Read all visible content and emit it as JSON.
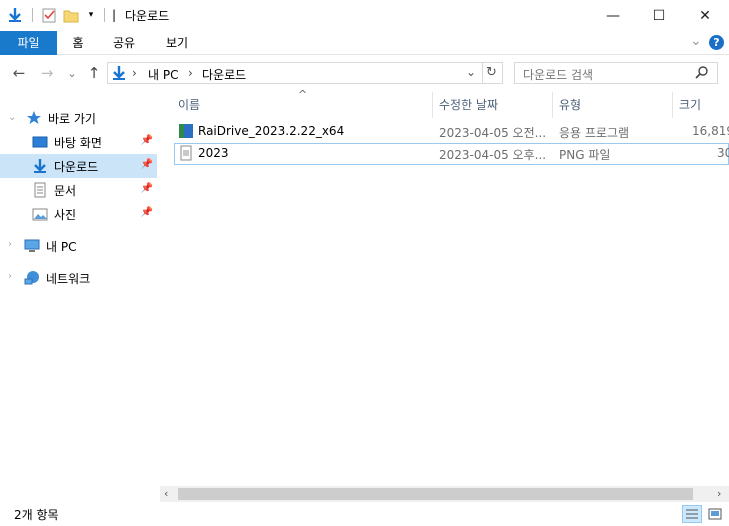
{
  "window": {
    "title": "다운로드",
    "minimize_glyph": "—",
    "maximize_glyph": "☐",
    "close_glyph": "✕"
  },
  "ribbon": {
    "tabs": [
      "파일",
      "홈",
      "공유",
      "보기"
    ],
    "help_glyph": "?",
    "expand_glyph": "⌄"
  },
  "nav": {
    "back_glyph": "←",
    "forward_glyph": "→",
    "recent_glyph": "⌄",
    "up_glyph": "↑",
    "address": {
      "root": "내 PC",
      "current": "다운로드",
      "sep": "›"
    },
    "search_placeholder": "다운로드 검색"
  },
  "tree": {
    "quick_access": "바로 가기",
    "pinned": [
      "바탕 화면",
      "다운로드",
      "문서",
      "사진"
    ],
    "this_pc": "내 PC",
    "network": "네트워크"
  },
  "columns": [
    "이름",
    "수정한 날짜",
    "유형",
    "크기"
  ],
  "sort_glyph": "^",
  "files": [
    {
      "name": "RaiDrive_2023.2.22_x64",
      "date": "2023-04-05 오전...",
      "type": "응용 프로그램",
      "size": "16,819"
    },
    {
      "name": "2023",
      "date": "2023-04-05 오후...",
      "type": "PNG 파일",
      "size": "30"
    }
  ],
  "status": {
    "count": "2개 항목"
  },
  "colors": {
    "accent": "#1979ca",
    "selected_bg": "#cce8ff",
    "selected_border": "#99c9ef",
    "nav_selected": "#cce4f7"
  }
}
